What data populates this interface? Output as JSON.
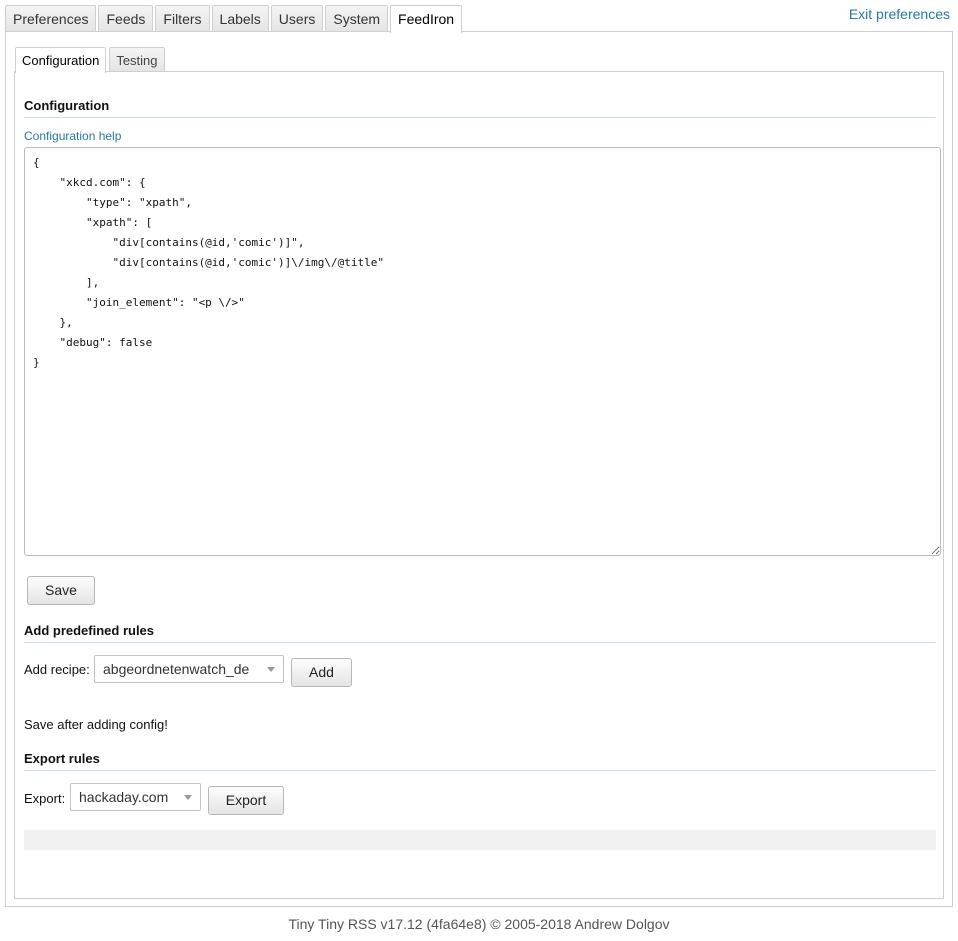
{
  "top_tabs": [
    "Preferences",
    "Feeds",
    "Filters",
    "Labels",
    "Users",
    "System",
    "FeedIron"
  ],
  "active_top_tab": "FeedIron",
  "exit_link": "Exit preferences",
  "inner_tabs": [
    "Configuration",
    "Testing"
  ],
  "active_inner_tab": "Configuration",
  "configuration": {
    "title": "Configuration",
    "help_link": "Configuration help",
    "editor_value": "{\n    \"xkcd.com\": {\n        \"type\": \"xpath\",\n        \"xpath\": [\n            \"div[contains(@id,'comic')]\",\n            \"div[contains(@id,'comic')]\\/img\\/@title\"\n        ],\n        \"join_element\": \"<p \\/>\"\n    },\n    \"debug\": false\n}",
    "save_label": "Save"
  },
  "predefined": {
    "title": "Add predefined rules",
    "recipe_label": "Add recipe:",
    "recipe_selected": "abgeordnetenwatch_de",
    "add_label": "Add",
    "note": "Save after adding config!"
  },
  "export": {
    "title": "Export rules",
    "label": "Export:",
    "selected": "hackaday.com",
    "button_label": "Export"
  },
  "footer": "Tiny Tiny RSS v17.12 (4fa64e8) © 2005-2018 Andrew Dolgov",
  "colors": {
    "link": "#257aa7",
    "border": "#cfcfcf",
    "section_rule": "#c6dcea"
  }
}
